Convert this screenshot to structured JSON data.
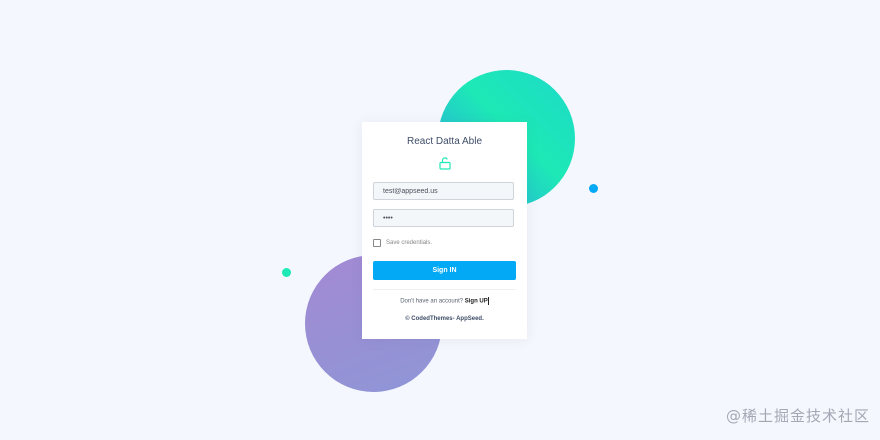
{
  "app": {
    "title": "React Datta Able"
  },
  "login_form": {
    "email_value": "test@appseed.us",
    "password_value": "••••",
    "remember_label": "Save credentials.",
    "remember_checked": false,
    "submit_label": "Sign IN",
    "no_account_text": "Don't have an account?",
    "signup_label": "Sign UP",
    "footer_text": "© CodedThemes- AppSeed."
  },
  "icons": {
    "lock": "unlock-icon"
  },
  "colors": {
    "accent": "#04a9f5",
    "teal": "#1de9b6",
    "purple": "#a389d4",
    "background": "#f4f7fd"
  },
  "watermark": "@稀土掘金技术社区"
}
